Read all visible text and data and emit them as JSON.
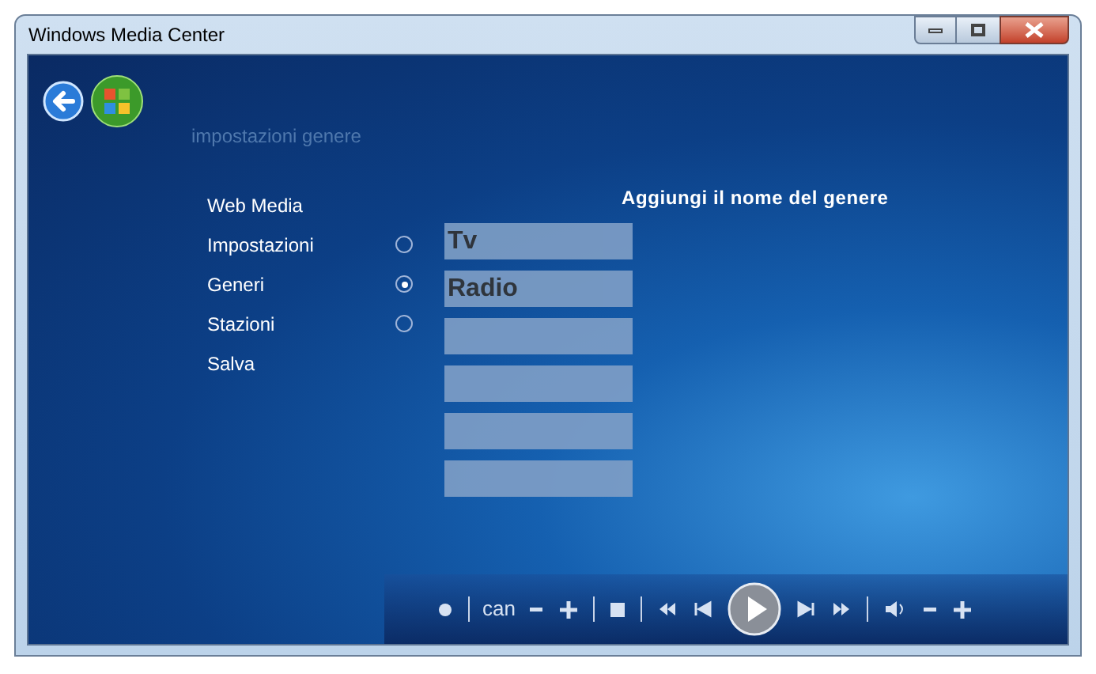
{
  "window": {
    "title": "Windows Media Center"
  },
  "page_title": "impostazioni genere",
  "menu": [
    {
      "kind": "plain",
      "label": "Web Media"
    },
    {
      "kind": "option",
      "label": "Impostazioni",
      "selected": false
    },
    {
      "kind": "option",
      "label": "Generi",
      "selected": true
    },
    {
      "kind": "option",
      "label": "Stazioni",
      "selected": false
    },
    {
      "kind": "plain",
      "label": "Salva"
    }
  ],
  "heading": "Aggiungi il nome del genere",
  "genre_fields": [
    {
      "kind": "text",
      "value": "Tv"
    },
    {
      "kind": "text",
      "value": "Radio"
    },
    {
      "kind": "blank"
    },
    {
      "kind": "blank"
    },
    {
      "kind": "blank"
    },
    {
      "kind": "blank"
    }
  ],
  "transport": {
    "channel_label": "can"
  }
}
